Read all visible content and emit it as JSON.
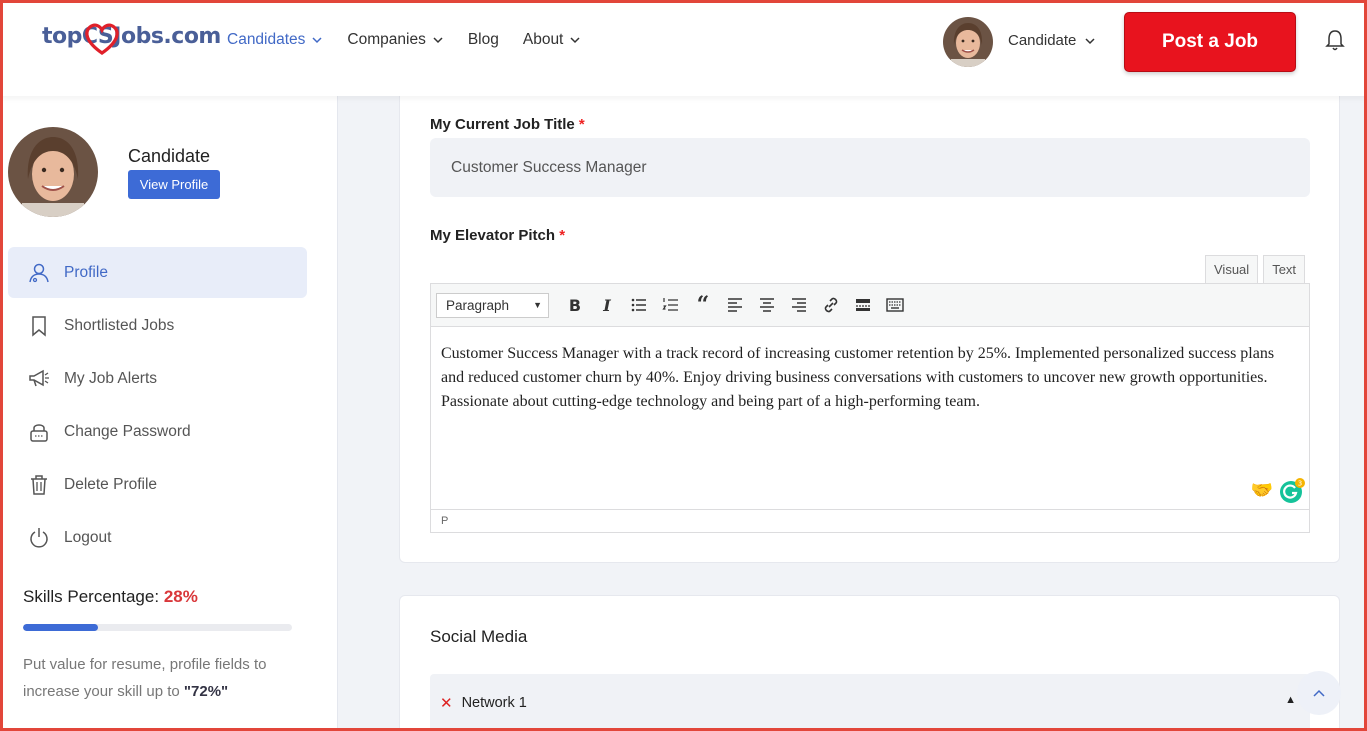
{
  "header": {
    "logo_text": "topCSJobs.com",
    "nav": [
      {
        "label": "Candidates",
        "has_dropdown": true,
        "active": true
      },
      {
        "label": "Companies",
        "has_dropdown": true,
        "active": false
      },
      {
        "label": "Blog",
        "has_dropdown": false,
        "active": false
      },
      {
        "label": "About",
        "has_dropdown": true,
        "active": false
      }
    ],
    "user_role": "Candidate",
    "post_job_label": "Post a Job",
    "bell_icon": "bell-icon"
  },
  "sidebar": {
    "name": "Candidate",
    "view_profile_label": "View Profile",
    "menu": [
      {
        "label": "Profile",
        "icon": "user-icon",
        "active": true
      },
      {
        "label": "Shortlisted Jobs",
        "icon": "bookmark-icon",
        "active": false
      },
      {
        "label": "My Job Alerts",
        "icon": "megaphone-icon",
        "active": false
      },
      {
        "label": "Change Password",
        "icon": "lock-icon",
        "active": false
      },
      {
        "label": "Delete Profile",
        "icon": "trash-icon",
        "active": false
      },
      {
        "label": "Logout",
        "icon": "power-icon",
        "active": false
      }
    ],
    "skills_label": "Skills Percentage:",
    "skills_percent": "28%",
    "skills_value": 28,
    "skills_note_prefix": "Put value for resume, profile fields to increase your skill up to",
    "skills_target": "\"72%\""
  },
  "form": {
    "job_title_label": "My Current Job Title",
    "required_mark": "*",
    "job_title_value": "Customer Success Manager",
    "pitch_label": "My Elevator Pitch",
    "editor_tabs": [
      "Visual",
      "Text"
    ],
    "paragraph_select": "Paragraph",
    "pitch_text": "Customer Success Manager with a track record of increasing customer retention by 25%. Implemented personalized success plans and reduced customer churn by 40%. Enjoy driving business conversations with customers to uncover new growth opportunities. Passionate about cutting-edge technology and being part of a high-performing team.",
    "status_path": "P",
    "grammarly_count": "3"
  },
  "social": {
    "title": "Social Media",
    "network_label": "Network 1"
  },
  "colors": {
    "accent": "#3d6bd6",
    "post_job": "#e8131e",
    "skills_pct": "#d9373a"
  }
}
